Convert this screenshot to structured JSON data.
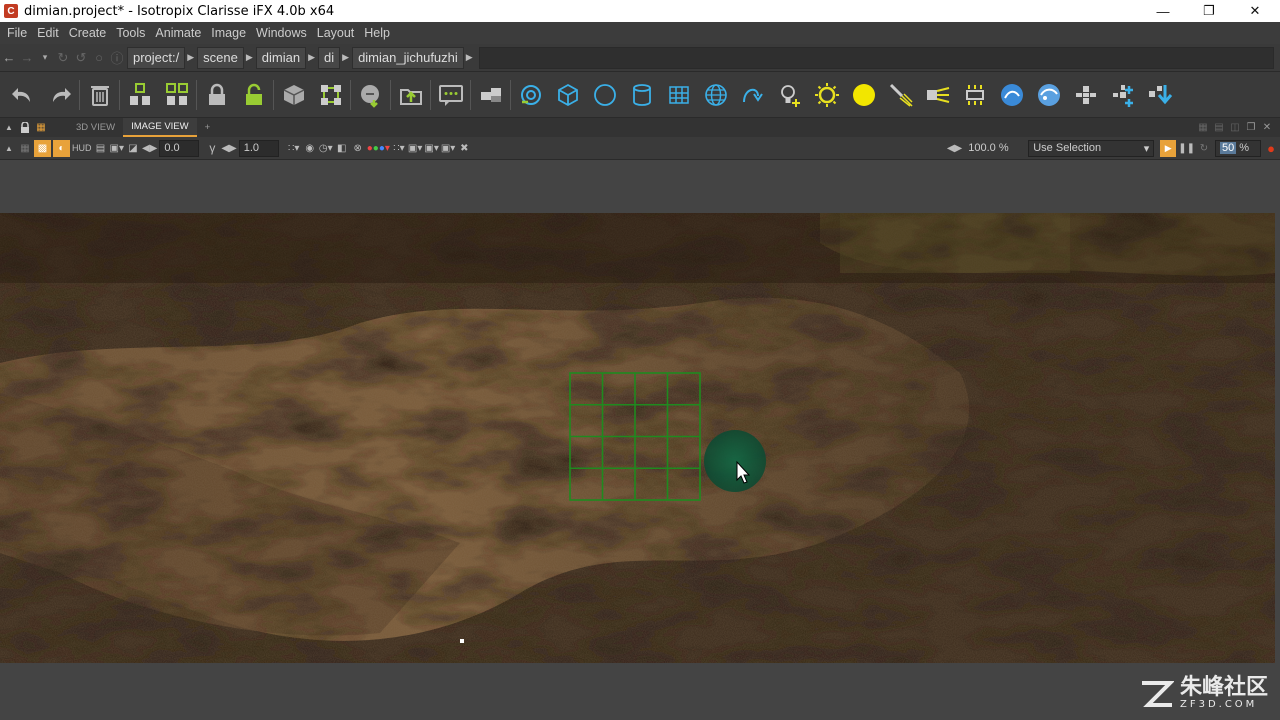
{
  "window": {
    "title": "dimian.project* - Isotropix Clarisse iFX 4.0b x64",
    "app_icon": "clarisse-icon"
  },
  "menubar": {
    "items": [
      "File",
      "Edit",
      "Create",
      "Tools",
      "Animate",
      "Image",
      "Windows",
      "Layout",
      "Help"
    ]
  },
  "pathbar": {
    "crumbs": [
      "project:/",
      "scene",
      "dimian",
      "di",
      "dimian_jichufuzhi"
    ]
  },
  "toolbar": {
    "icons": [
      "undo-icon",
      "redo-icon",
      "delete-icon",
      "group-icon",
      "ungroup-icon",
      "lock-icon",
      "unlock-icon",
      "context-icon",
      "instance-icon",
      "import-icon",
      "export-icon",
      "comment-icon",
      "layer-icon",
      "camera-icon",
      "box-icon",
      "sphere-icon",
      "cylinder-icon",
      "grid-icon",
      "globe-icon",
      "curve-icon",
      "light-icon",
      "sun-icon",
      "yellow-light-icon",
      "spotlight-icon",
      "directional-light-icon",
      "area-light-icon",
      "sky-icon",
      "environment-icon",
      "particle-icon",
      "scatter-icon",
      "download-icon"
    ]
  },
  "tabs": {
    "items": [
      "3D VIEW",
      "IMAGE VIEW"
    ],
    "add_label": "+",
    "active": "IMAGE VIEW"
  },
  "viewtb": {
    "hud_label": "HUD",
    "exposure": "0.0",
    "gamma_label": "γ",
    "gamma": "1.0",
    "zoom": "100.0 %",
    "selection_mode": "Use Selection",
    "sampling_pct": "50",
    "pct_sign": "%"
  },
  "watermark": {
    "cn": "朱峰社区",
    "en": "ZF3D.COM"
  },
  "colors": {
    "accent": "#e8a23a",
    "render_record": "#e03a1a",
    "grid_green": "#1f8a1f",
    "cursor_highlight": "#0a5a3c"
  }
}
